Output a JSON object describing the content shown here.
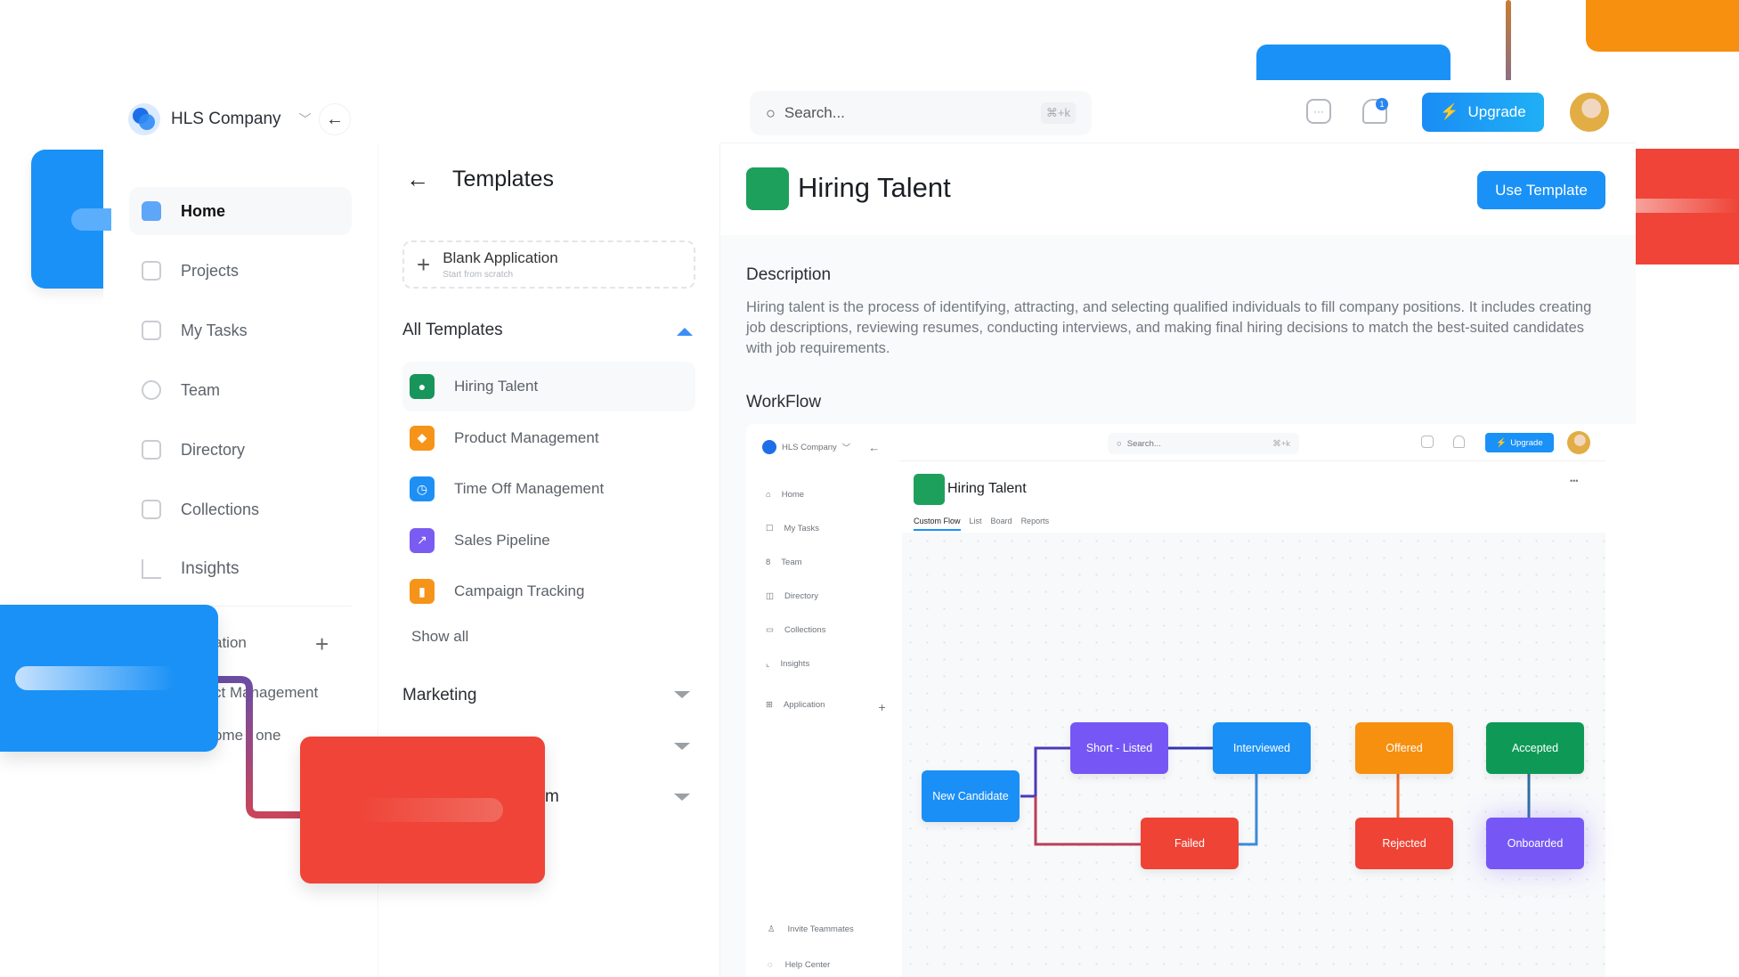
{
  "workspace": {
    "name": "HLS Company"
  },
  "sidebar": {
    "items": [
      {
        "label": "Home",
        "icon": "home-icon",
        "active": true
      },
      {
        "label": "Projects",
        "icon": "clipboard-icon"
      },
      {
        "label": "My Tasks",
        "icon": "checkbox-icon"
      },
      {
        "label": "Team",
        "icon": "team-icon"
      },
      {
        "label": "Directory",
        "icon": "book-icon"
      },
      {
        "label": "Collections",
        "icon": "folder-icon"
      },
      {
        "label": "Insights",
        "icon": "chart-icon"
      }
    ],
    "section_label_partial": "ation",
    "sub_items_partial": [
      "ct Management",
      "ome",
      "one"
    ]
  },
  "templates_panel": {
    "title": "Templates",
    "blank": {
      "title": "Blank Application",
      "subtitle": "Start from scratch"
    },
    "all_templates_label": "All Templates",
    "items": [
      {
        "label": "Hiring Talent",
        "color": "#17955a"
      },
      {
        "label": "Product Management",
        "color": "#f59418"
      },
      {
        "label": "Time Off Management",
        "color": "#1e90f5"
      },
      {
        "label": "Sales Pipeline",
        "color": "#7a5cf2"
      },
      {
        "label": "Campaign Tracking",
        "color": "#f59418"
      }
    ],
    "show_all": "Show all",
    "marketing_label": "Marketing",
    "partial_label": "m"
  },
  "topbar": {
    "search_placeholder": "Search...",
    "shortcut": "⌘+k",
    "notification_count": "1",
    "upgrade_label": "Upgrade"
  },
  "detail": {
    "title": "Hiring Talent",
    "use_template_label": "Use Template",
    "description_heading": "Description",
    "description": "Hiring talent is the process of identifying, attracting, and selecting qualified individuals to fill company positions. It includes creating job descriptions, reviewing resumes, conducting interviews, and making final hiring decisions to match the best-suited candidates with job requirements.",
    "workflow_heading": "WorkFlow"
  },
  "preview": {
    "workspace": "HLS Company",
    "search_placeholder": "Search...",
    "shortcut": "⌘+k",
    "upgrade_label": "Upgrade",
    "nav": [
      "Home",
      "My Tasks",
      "Team",
      "Directory",
      "Collections",
      "Insights"
    ],
    "application_label": "Application",
    "invite": "Invite Teammates",
    "help": "Help Center",
    "title": "Hiring Talent",
    "tabs": [
      "Custom Flow",
      "List",
      "Board",
      "Reports"
    ],
    "more": "•••",
    "nodes": [
      {
        "label": "New Candidate",
        "color": "#1a8ff6"
      },
      {
        "label": "Short - Listed",
        "color": "#7657f5"
      },
      {
        "label": "Interviewed",
        "color": "#1a8ff6"
      },
      {
        "label": "Offered",
        "color": "#f7900f"
      },
      {
        "label": "Accepted",
        "color": "#0e9a56"
      },
      {
        "label": "Failed",
        "color": "#ee4335"
      },
      {
        "label": "Rejected",
        "color": "#ee4335"
      },
      {
        "label": "Onboarded",
        "color": "#7657f5"
      }
    ]
  }
}
